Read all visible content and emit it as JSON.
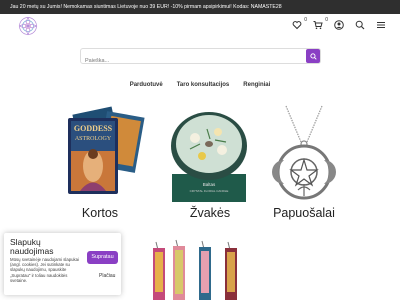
{
  "announcement": "Jau 20 metų su Jumis! Nemokamas siuntimas Lietuvoje nuo 39 EUR! -10% pirmam apsipirkimui! Kodas: NAMASTE28",
  "header": {
    "wishlist_count": "0",
    "cart_count": "0"
  },
  "search": {
    "placeholder": "Paieška..."
  },
  "nav": {
    "items": [
      {
        "label": "Parduotuvė"
      },
      {
        "label": "Taro konsultacijos"
      },
      {
        "label": "Renginiai"
      }
    ]
  },
  "products": [
    {
      "label": "Kortos",
      "icon": "tarot-cards-image"
    },
    {
      "label": "Žvakės",
      "icon": "candle-image"
    },
    {
      "label": "Papuošalai",
      "icon": "pendant-image"
    }
  ],
  "cookie": {
    "title": "Slapukų naudojimas",
    "text": "Mūsų svetainėje naudojami slapukai (angl. cookies). Jei sutinkate su slapukų naudojimu, spauskite „Supratau\" ir toliau naudokitės svetaine.",
    "accept_label": "Supratau",
    "more_label": "Plačiau"
  },
  "colors": {
    "accent": "#8a3fc4",
    "topbar": "#2f2f2f"
  }
}
